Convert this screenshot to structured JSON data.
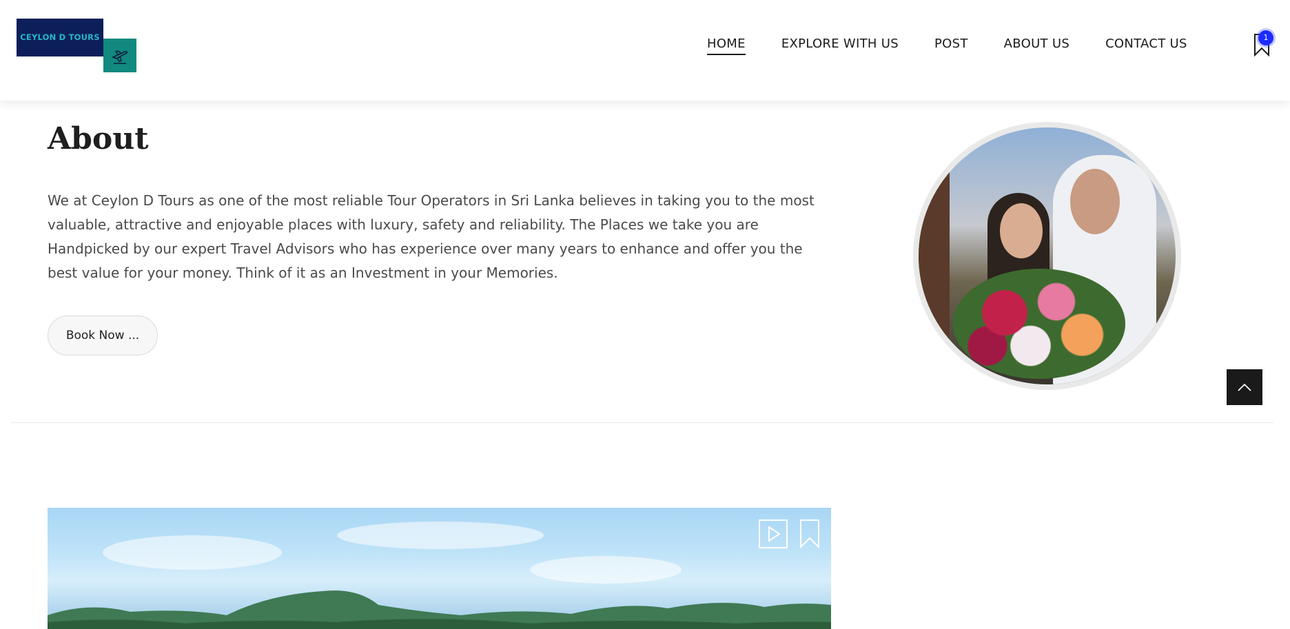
{
  "brand": {
    "logo_text": "CEYLON D TOURS",
    "colors": {
      "navy": "#0c1f5a",
      "teal": "#11897e",
      "badge": "#1d2bff"
    }
  },
  "nav": {
    "items": [
      {
        "label": "HOME",
        "active": true
      },
      {
        "label": "EXPLORE WITH US"
      },
      {
        "label": "POST"
      },
      {
        "label": "ABOUT US"
      },
      {
        "label": "CONTACT US"
      }
    ],
    "saved_count": "1",
    "saved_icon": "bookmark-icon"
  },
  "about": {
    "title": "About",
    "body": "We at Ceylon D Tours as one of the most reliable Tour Operators in Sri Lanka believes in taking you to the most valuable, attractive and enjoyable places with luxury, safety and reliability. The Places we take you are Handpicked by our expert Travel Advisors who has experience over many years to enhance and offer you the best value for your money. Think of it as an Investment in your Memories.",
    "cta_label": "Book Now ..."
  },
  "icons": {
    "scroll_top": "chevron-up-icon",
    "logo_plane": "airplane-icon",
    "media_play": "play-icon",
    "media_save": "bookmark-icon"
  }
}
